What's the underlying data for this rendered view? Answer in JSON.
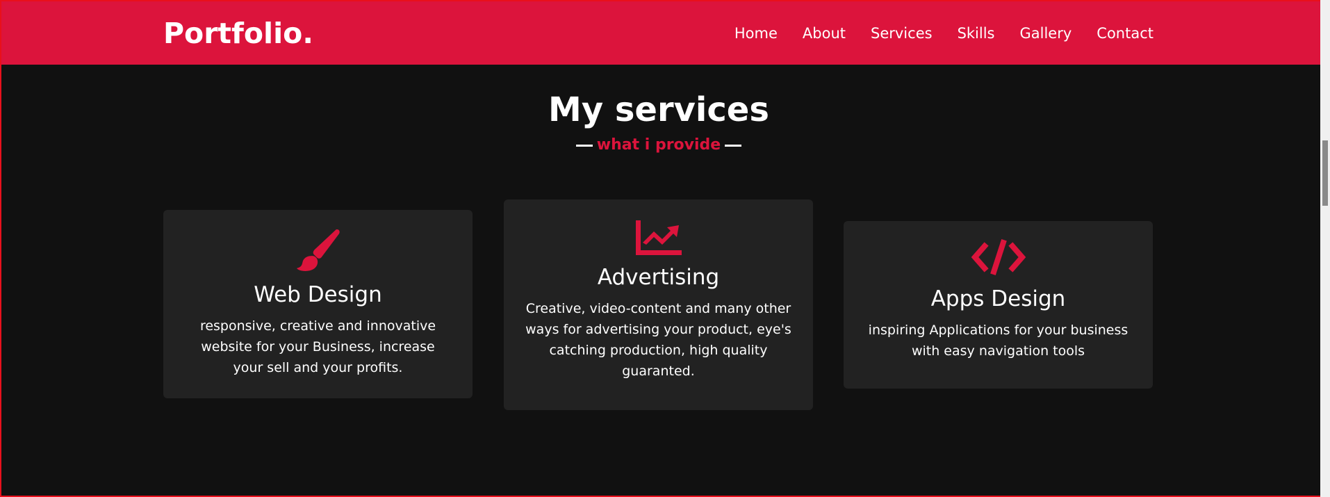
{
  "header": {
    "logo": "Portfolio.",
    "nav": [
      "Home",
      "About",
      "Services",
      "Skills",
      "Gallery",
      "Contact"
    ]
  },
  "services": {
    "title": "My services",
    "subtitle": "what i provide",
    "cards": [
      {
        "icon": "paint-brush-icon",
        "title": "Web Design",
        "description": "responsive, creative and innovative website for your Business, increase your sell and your profits."
      },
      {
        "icon": "chart-line-icon",
        "title": "Advertising",
        "description": "Creative, video-content and many other ways for advertising your product, eye's catching production, high quality guaranted."
      },
      {
        "icon": "code-icon",
        "title": "Apps Design",
        "description": "inspiring Applications for your business with easy navigation tools"
      }
    ]
  },
  "colors": {
    "accent": "#dc143c",
    "background": "#111111",
    "card": "#222222"
  }
}
